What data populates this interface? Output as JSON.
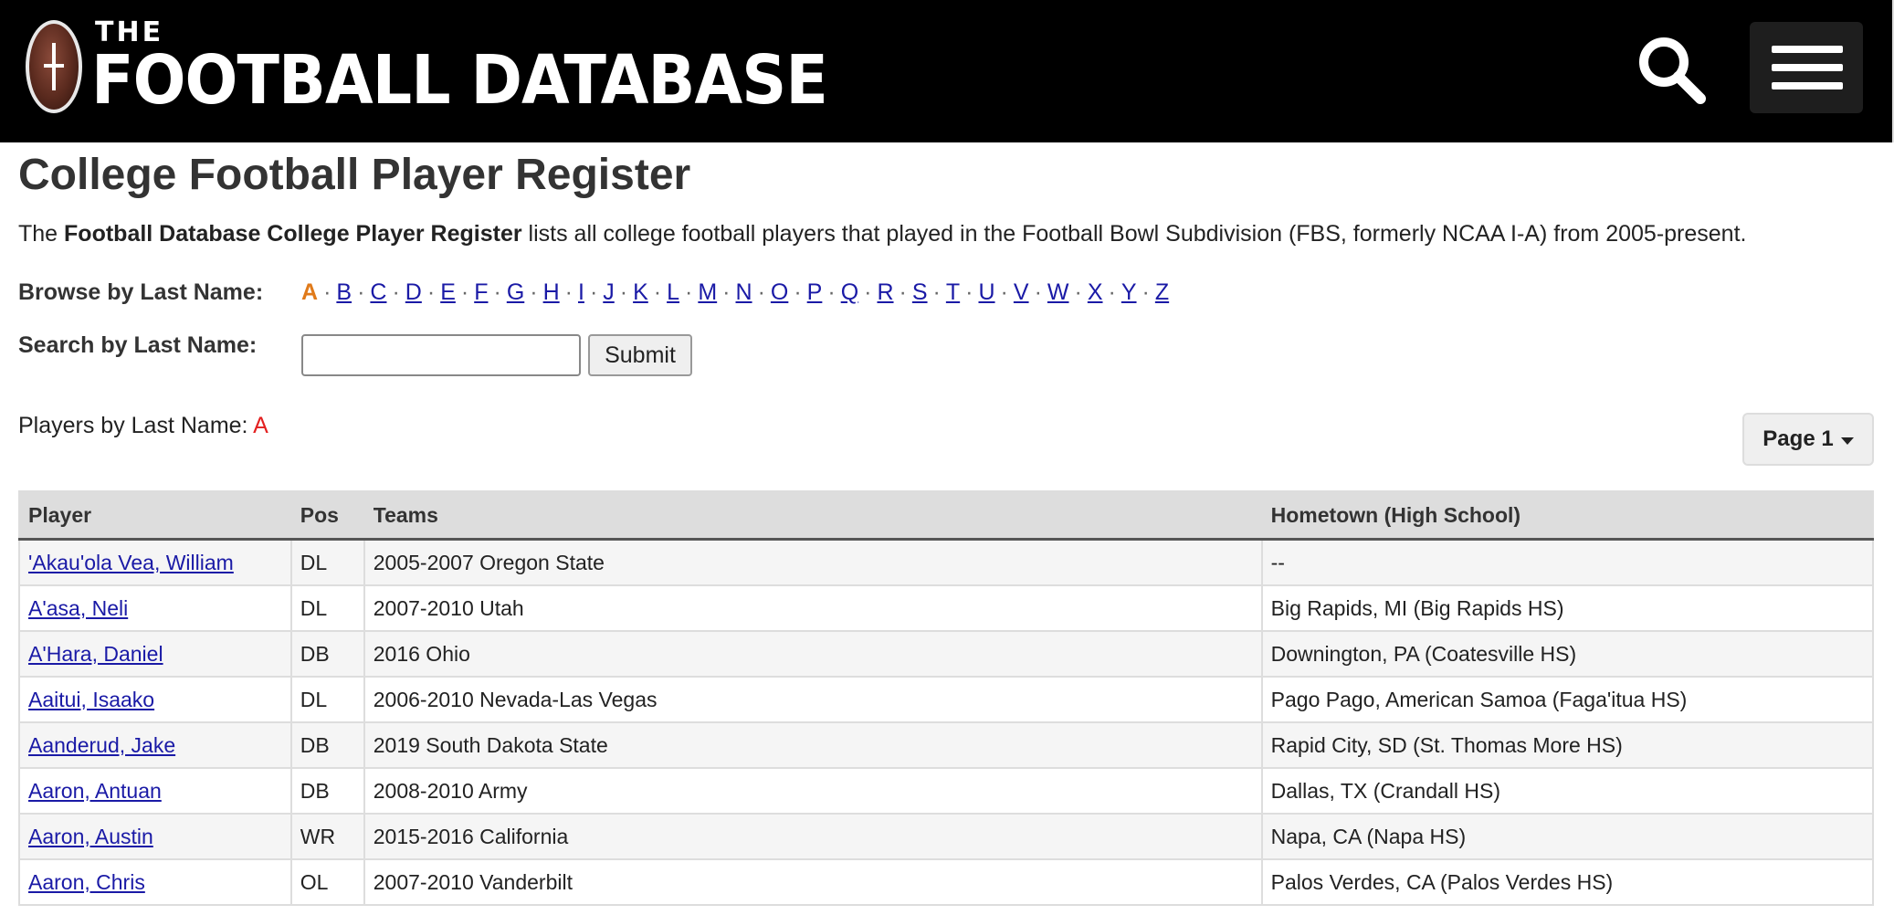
{
  "header": {
    "logo": {
      "small": "THE",
      "big": "FOOTBALL DATABASE"
    },
    "search_icon": "search-icon",
    "menu_icon": "hamburger-menu-icon",
    "background": "#000000"
  },
  "page": {
    "title": "College Football Player Register",
    "intro_prefix": "The ",
    "intro_bold": "Football Database College Player Register",
    "intro_suffix": " lists all college football players that played in the Football Bowl Subdivision (FBS, formerly NCAA I-A) from 2005-present."
  },
  "browse": {
    "label": "Browse by Last Name:",
    "current": "A",
    "letters": [
      "B",
      "C",
      "D",
      "E",
      "F",
      "G",
      "H",
      "I",
      "J",
      "K",
      "L",
      "M",
      "N",
      "O",
      "P",
      "Q",
      "R",
      "S",
      "T",
      "U",
      "V",
      "W",
      "X",
      "Y",
      "Z"
    ]
  },
  "search": {
    "label": "Search by Last Name:",
    "value": "",
    "submit_label": "Submit"
  },
  "players_by": {
    "label": "Players by Last Name: ",
    "letter": "A"
  },
  "pagination": {
    "label": "Page 1"
  },
  "table": {
    "headers": [
      "Player",
      "Pos",
      "Teams",
      "Hometown (High School)"
    ],
    "rows": [
      {
        "player": "'Akau'ola Vea, William",
        "pos": "DL",
        "teams": "2005-2007 Oregon State",
        "hometown": "--"
      },
      {
        "player": "A'asa, Neli",
        "pos": "DL",
        "teams": "2007-2010 Utah",
        "hometown": "Big Rapids, MI (Big Rapids HS)"
      },
      {
        "player": "A'Hara, Daniel",
        "pos": "DB",
        "teams": "2016 Ohio",
        "hometown": "Downington, PA (Coatesville HS)"
      },
      {
        "player": "Aaitui, Isaako",
        "pos": "DL",
        "teams": "2006-2010 Nevada-Las Vegas",
        "hometown": "Pago Pago, American Samoa (Faga'itua HS)"
      },
      {
        "player": "Aanderud, Jake",
        "pos": "DB",
        "teams": "2019 South Dakota State",
        "hometown": "Rapid City, SD (St. Thomas More HS)"
      },
      {
        "player": "Aaron, Antuan",
        "pos": "DB",
        "teams": "2008-2010 Army",
        "hometown": "Dallas, TX (Crandall HS)"
      },
      {
        "player": "Aaron, Austin",
        "pos": "WR",
        "teams": "2015-2016 California",
        "hometown": "Napa, CA (Napa HS)"
      },
      {
        "player": "Aaron, Chris",
        "pos": "OL",
        "teams": "2007-2010 Vanderbilt",
        "hometown": "Palos Verdes, CA (Palos Verdes HS)"
      }
    ]
  },
  "colors": {
    "link": "#1a1aa6",
    "current_letter": "#e07a1a",
    "players_letter": "#e32020"
  }
}
